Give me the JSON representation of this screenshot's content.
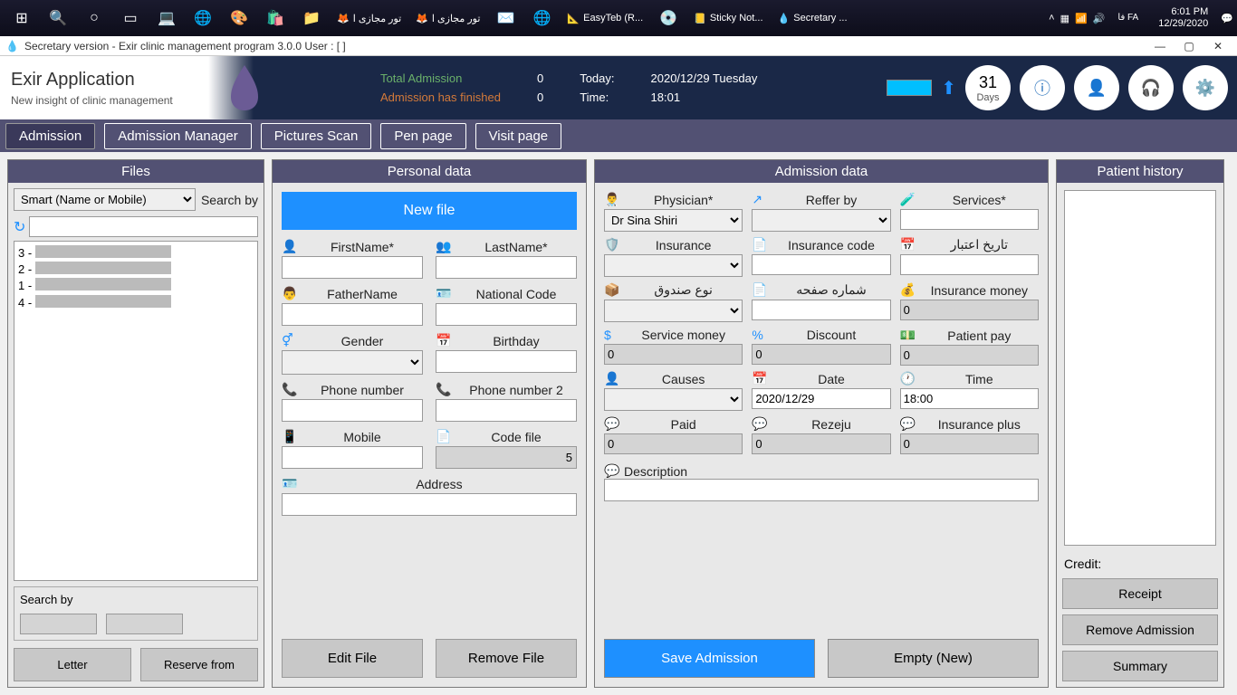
{
  "taskbar": {
    "items": [
      "تور مجازی ا",
      "تور مجازی ا",
      "EasyTeb (R...",
      "Sticky Not...",
      "Secretary ..."
    ],
    "lang": "فا\nFA",
    "time": "6:01 PM",
    "date": "12/29/2020"
  },
  "titlebar": {
    "text": "Secretary version - Exir clinic management program 3.0.0 User : [ ]"
  },
  "header": {
    "title": "Exir Application",
    "subtitle": "New insight of clinic management",
    "total_adm_lbl": "Total Admission",
    "total_adm_val": "0",
    "finished_lbl": "Admission has finished",
    "finished_val": "0",
    "today_lbl": "Today:",
    "today_val": "2020/12/29  Tuesday",
    "time_lbl": "Time:",
    "time_val": "18:01",
    "days_num": "31",
    "days_lbl": "Days"
  },
  "tabs": {
    "admission": "Admission",
    "manager": "Admission Manager",
    "pictures": "Pictures  Scan",
    "pen": "Pen page",
    "visit": "Visit page"
  },
  "files": {
    "title": "Files",
    "search_option": "Smart (Name or Mobile)",
    "search_by_lbl": "Search by",
    "list": [
      "3 -",
      "2 -",
      "1 -",
      "4 -"
    ],
    "search_by2": "Search by",
    "letter_btn": "Letter",
    "reserve_btn": "Reserve from"
  },
  "personal": {
    "title": "Personal data",
    "new_file": "New file",
    "firstname": "FirstName*",
    "lastname": "LastName*",
    "fathername": "FatherName",
    "national": "National Code",
    "gender": "Gender",
    "birthday": "Birthday",
    "phone1": "Phone number",
    "phone2": "Phone number 2",
    "mobile": "Mobile",
    "codefile": "Code file",
    "codefile_val": "5",
    "address": "Address",
    "edit_btn": "Edit File",
    "remove_btn": "Remove File"
  },
  "admission": {
    "title": "Admission data",
    "physician": "Physician*",
    "physician_val": "Dr Sina Shiri",
    "reffer": "Reffer by",
    "services": "Services*",
    "insurance": "Insurance",
    "ins_code": "Insurance code",
    "exp_date": "تاريخ اعتبار",
    "box_type": "نوع صندوق",
    "page_num": "شماره صفحه",
    "ins_money": "Insurance money",
    "ins_money_val": "0",
    "service_money": "Service money",
    "service_money_val": "0",
    "discount": "Discount",
    "discount_val": "0",
    "patient_pay": "Patient pay",
    "patient_pay_val": "0",
    "causes": "Causes",
    "date": "Date",
    "date_val": "2020/12/29",
    "time": "Time",
    "time_val": "18:00",
    "paid": "Paid",
    "paid_val": "0",
    "rezeju": "Rezeju",
    "rezeju_val": "0",
    "ins_plus": "Insurance plus",
    "ins_plus_val": "0",
    "description": "Description",
    "save_btn": "Save Admission",
    "empty_btn": "Empty (New)"
  },
  "history": {
    "title": "Patient history",
    "credit": "Credit:",
    "receipt": "Receipt",
    "remove": "Remove Admission",
    "summary": "Summary"
  }
}
